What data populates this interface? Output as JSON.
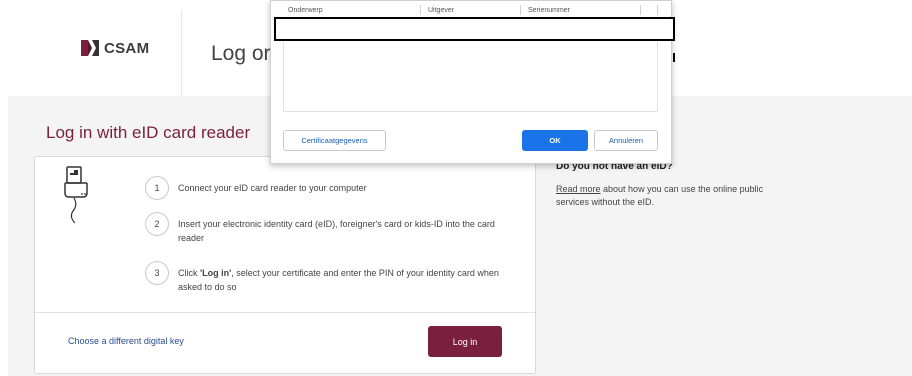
{
  "header": {
    "logo_text": "CSAM",
    "title": "Log or"
  },
  "dialog": {
    "columns": [
      "Onderwerp",
      "Uitgever",
      "Serienummer"
    ],
    "buttons": {
      "certificate": "Certificaatgegevens",
      "ok": "OK",
      "cancel": "Annuleren"
    }
  },
  "main": {
    "title": "Log in with eID card reader",
    "steps": [
      {
        "num": "1",
        "text": "Connect your eID card reader to your computer"
      },
      {
        "num": "2",
        "text": "Insert your electronic identity card (eID), foreigner's card or kids-ID into the card reader"
      },
      {
        "num": "3",
        "text_bold": "'Log in'",
        "text_pre": "Click ",
        "text_post": ", select your certificate and enter the PIN of your identity card when asked to do so"
      }
    ],
    "alt_link": "Choose a different digital key",
    "login_button": "Log in"
  },
  "aside": {
    "title": "Do you not have an eID?",
    "link": "Read more",
    "text": " about how you can use the online public services without the eID."
  },
  "colors": {
    "brand": "#7a1f3d",
    "primary_button": "#1a73e8",
    "link": "#2a4f8f"
  }
}
